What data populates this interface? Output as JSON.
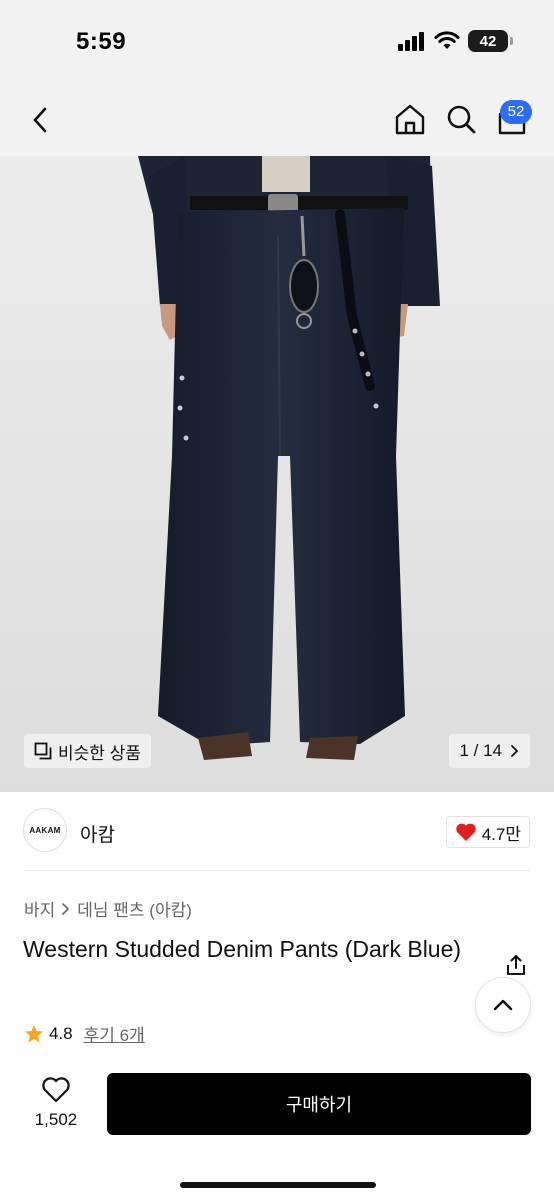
{
  "status_bar": {
    "time": "5:59",
    "battery": "42",
    "icons": [
      "signal-icon",
      "wifi-icon",
      "battery-icon"
    ]
  },
  "nav": {
    "icons": [
      "back-icon",
      "home-icon",
      "search-icon",
      "cart-icon"
    ],
    "cart_count": "52"
  },
  "gallery": {
    "similar_label": "비슷한 상품",
    "pager": "1 / 14"
  },
  "brand": {
    "logo_text": "AAKAM",
    "name": "아캄",
    "likes": "4.7만"
  },
  "product": {
    "breadcrumb": [
      "바지",
      "데님 팬츠 (아캄)"
    ],
    "title": "Western Studded Denim Pants (Dark Blue)",
    "rating": "4.8",
    "reviews_label": "후기 6개"
  },
  "bottom_bar": {
    "wish_count": "1,502",
    "buy_label": "구매하기"
  },
  "colors": {
    "accent_badge": "#2f6cf6",
    "like_heart": "#e02020",
    "star": "#f5a623",
    "denim": "#1c2233",
    "buy_button": "#000000"
  }
}
